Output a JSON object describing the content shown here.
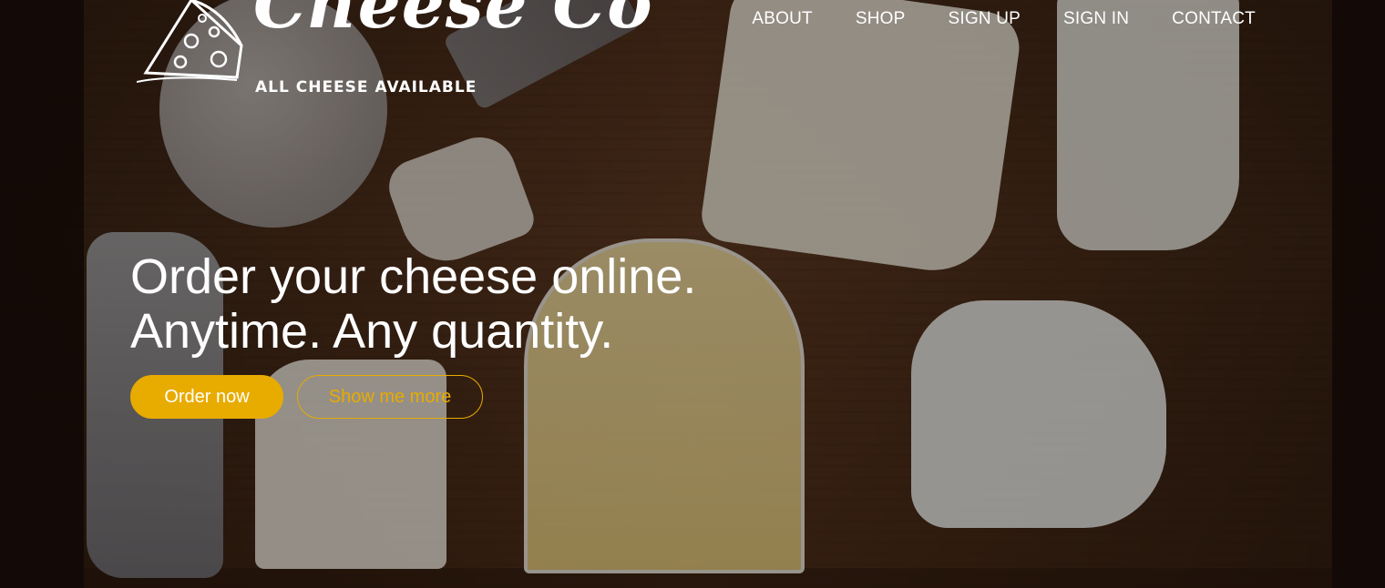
{
  "brand": {
    "name": "Cheese Co",
    "tagline": "ALL CHEESE AVAILABLE",
    "logo_icon": "cheese-wedge-icon"
  },
  "nav": {
    "items": [
      {
        "label": "ABOUT"
      },
      {
        "label": "SHOP"
      },
      {
        "label": "SIGN UP"
      },
      {
        "label": "SIGN IN"
      },
      {
        "label": "CONTACT"
      }
    ]
  },
  "hero": {
    "headline_line1": "Order your cheese online.",
    "headline_line2": "Anytime. Any quantity.",
    "primary_button": "Order now",
    "secondary_button": "Show me more",
    "background": "cheese-board-photo"
  },
  "colors": {
    "accent": "#e8ab00",
    "text": "#ffffff"
  }
}
